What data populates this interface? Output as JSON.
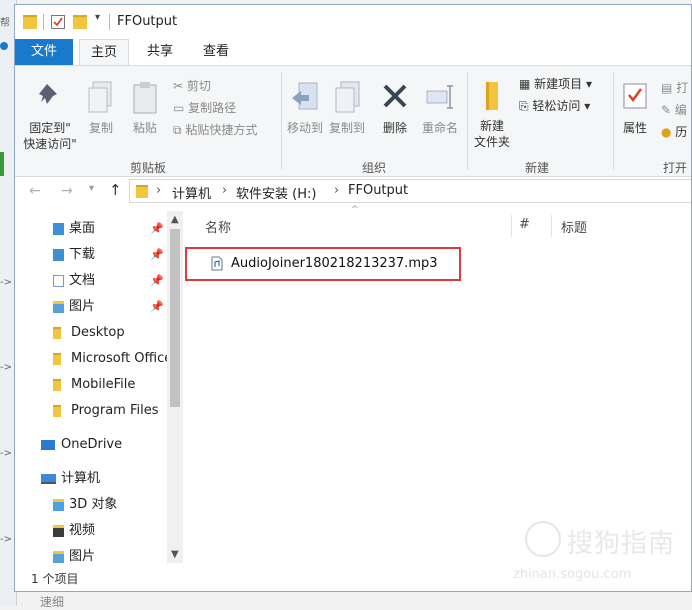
{
  "background_window": {
    "marks": [
      "帮",
      "->",
      "->",
      "->",
      "->"
    ]
  },
  "window": {
    "title": "FFOutput",
    "tabs": [
      {
        "label": "文件"
      },
      {
        "label": "主页"
      },
      {
        "label": "共享"
      },
      {
        "label": "查看"
      }
    ]
  },
  "ribbon": {
    "clipboard": {
      "group_name": "剪贴板",
      "pin_label_1": "固定到\"",
      "pin_label_2": "快速访问\"",
      "copy": "复制",
      "paste": "粘贴",
      "cut": "剪切",
      "copy_path": "复制路径",
      "paste_shortcut": "粘贴快捷方式"
    },
    "organize": {
      "group_name": "组织",
      "move_to": "移动到",
      "copy_to": "复制到",
      "delete": "删除",
      "rename": "重命名"
    },
    "new": {
      "group_name": "新建",
      "new_folder_1": "新建",
      "new_folder_2": "文件夹",
      "new_item": "新建项目",
      "easy_access": "轻松访问"
    },
    "open": {
      "group_name": "打开",
      "properties": "属性",
      "open_partial": "打",
      "edit_partial": "编",
      "history_partial": "历"
    }
  },
  "address": {
    "path": [
      "计算机",
      "软件安装 (H:)",
      "FFOutput"
    ],
    "separator": "›"
  },
  "nav": {
    "quick_access": [
      {
        "label": "桌面",
        "pinned": true,
        "icon": "desktop-folder-icon"
      },
      {
        "label": "下载",
        "pinned": true,
        "icon": "downloads-folder-icon"
      },
      {
        "label": "文档",
        "pinned": true,
        "icon": "documents-folder-icon"
      },
      {
        "label": "图片",
        "pinned": true,
        "icon": "pictures-folder-icon"
      },
      {
        "label": "Desktop",
        "pinned": false,
        "icon": "folder-icon"
      },
      {
        "label": "Microsoft Office",
        "pinned": false,
        "icon": "folder-icon"
      },
      {
        "label": "MobileFile",
        "pinned": false,
        "icon": "folder-icon"
      },
      {
        "label": "Program Files",
        "pinned": false,
        "icon": "folder-icon"
      }
    ],
    "onedrive": "OneDrive",
    "computer": "计算机",
    "computer_items": [
      {
        "label": "3D 对象",
        "icon": "3d-objects-folder-icon"
      },
      {
        "label": "视频",
        "icon": "videos-folder-icon"
      },
      {
        "label": "图片",
        "icon": "pictures-folder-icon"
      }
    ]
  },
  "content": {
    "columns": [
      "名称",
      "#",
      "标题"
    ],
    "files": [
      {
        "name": "AudioJoiner180218213237.mp3",
        "highlighted": true
      }
    ]
  },
  "status": {
    "item_count": "1 个项目"
  },
  "watermark": {
    "main": "搜狗指南",
    "url": "zhinan.sogou.com"
  },
  "colors": {
    "accent": "#1979ca",
    "highlight_box": "#e0393e",
    "folder": "#f2c440"
  }
}
